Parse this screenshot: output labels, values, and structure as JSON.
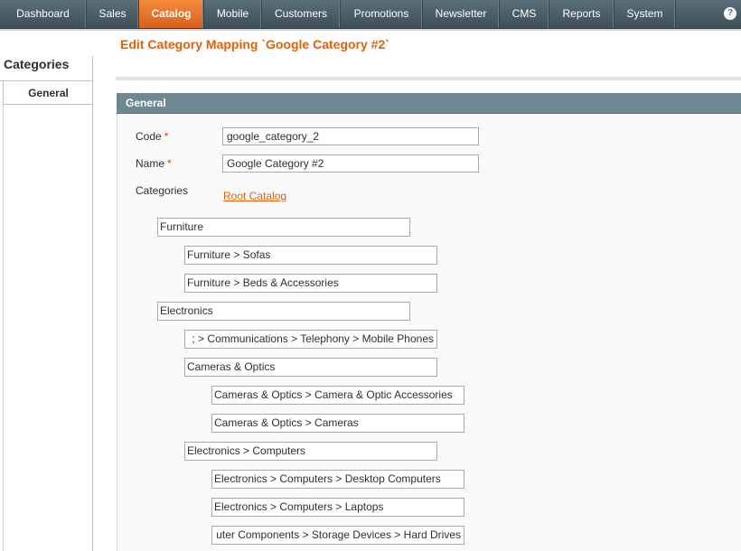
{
  "nav": {
    "items": [
      {
        "label": "Dashboard"
      },
      {
        "label": "Sales"
      },
      {
        "label": "Catalog",
        "active": true
      },
      {
        "label": "Mobile"
      },
      {
        "label": "Customers"
      },
      {
        "label": "Promotions"
      },
      {
        "label": "Newsletter"
      },
      {
        "label": "CMS"
      },
      {
        "label": "Reports"
      },
      {
        "label": "System"
      }
    ],
    "help_glyph": "?"
  },
  "sidebar": {
    "title": "Categories",
    "tabs": [
      {
        "label": "General"
      }
    ]
  },
  "page": {
    "title": "Edit Category Mapping `Google Category #2`"
  },
  "form": {
    "section_title": "General",
    "code_label": "Code",
    "name_label": "Name",
    "required_mark": "*",
    "code_value": "google_category_2",
    "name_value": "Google Category #2",
    "categories_label": "Categories",
    "root_link": "Root Catalog"
  },
  "tree": [
    {
      "level": 0,
      "value": "Furniture"
    },
    {
      "level": 1,
      "value": "Furniture > Sofas"
    },
    {
      "level": 1,
      "value": "Furniture > Beds & Accessories"
    },
    {
      "level": 0,
      "value": "Electronics"
    },
    {
      "level": 1,
      "value": "Electronics > Communications > Telephony > Mobile Phones",
      "visible": "; > Communications > Telephony > Mobile Phones"
    },
    {
      "level": 1,
      "value": "Cameras & Optics"
    },
    {
      "level": 2,
      "value": "Cameras & Optics > Camera & Optic Accessories"
    },
    {
      "level": 2,
      "value": "Cameras & Optics > Cameras"
    },
    {
      "level": 1,
      "value": "Electronics > Computers"
    },
    {
      "level": 2,
      "value": "Electronics > Computers > Desktop Computers"
    },
    {
      "level": 2,
      "value": "Electronics > Computers > Laptops"
    },
    {
      "level": 2,
      "value": "Electronics > Computers > Computer Components > Storage Devices > Hard Drives",
      "visible": "uter Components > Storage Devices > Hard Drives"
    }
  ],
  "colors": {
    "accent": "#eb5e00",
    "nav_bg": "#4b5d66",
    "section_head": "#6f8992"
  }
}
